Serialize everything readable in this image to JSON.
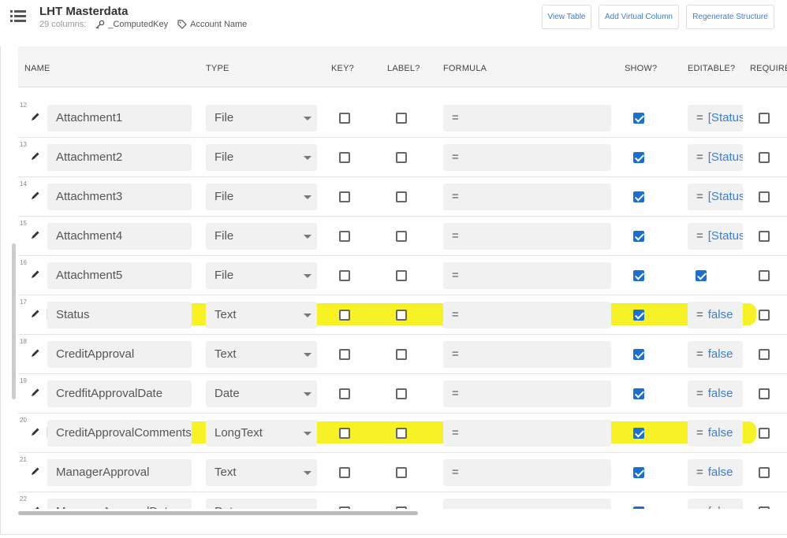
{
  "header": {
    "title": "LHT Masterdata",
    "columns_count": "29 columns:",
    "key_label": "_ComputedKey",
    "label_label": "Account Name",
    "btn_view_table": "View Table",
    "btn_add_virtual": "Add Virtual Column",
    "btn_regenerate": "Regenerate Structure"
  },
  "table": {
    "headers": {
      "name": "NAME",
      "type": "TYPE",
      "key": "KEY?",
      "label": "LABEL?",
      "formula": "FORMULA",
      "show": "SHOW?",
      "editable": "EDITABLE?",
      "require": "REQUIRE"
    },
    "rows": [
      {
        "num": "12",
        "name": "Attachment1",
        "type": "File",
        "formula": "=",
        "show": true,
        "editable_kind": "formula",
        "editable_value": "[Status",
        "highlight": false
      },
      {
        "num": "13",
        "name": "Attachment2",
        "type": "File",
        "formula": "=",
        "show": true,
        "editable_kind": "formula",
        "editable_value": "[Status",
        "highlight": false
      },
      {
        "num": "14",
        "name": "Attachment3",
        "type": "File",
        "formula": "=",
        "show": true,
        "editable_kind": "formula",
        "editable_value": "[Status",
        "highlight": false
      },
      {
        "num": "15",
        "name": "Attachment4",
        "type": "File",
        "formula": "=",
        "show": true,
        "editable_kind": "formula",
        "editable_value": "[Status",
        "highlight": false
      },
      {
        "num": "16",
        "name": "Attachment5",
        "type": "File",
        "formula": "=",
        "show": true,
        "editable_kind": "checkbox",
        "editable_value": "",
        "highlight": false
      },
      {
        "num": "17",
        "name": "Status",
        "type": "Text",
        "formula": "=",
        "show": true,
        "editable_kind": "formula",
        "editable_value": "false",
        "highlight": true
      },
      {
        "num": "18",
        "name": "CreditApproval",
        "type": "Text",
        "formula": "=",
        "show": true,
        "editable_kind": "formula",
        "editable_value": "false",
        "highlight": false
      },
      {
        "num": "19",
        "name": "CredfitApprovalDate",
        "type": "Date",
        "formula": "=",
        "show": true,
        "editable_kind": "formula",
        "editable_value": "false",
        "highlight": false
      },
      {
        "num": "20",
        "name": "CreditApprovalComments",
        "type": "LongText",
        "formula": "=",
        "show": true,
        "editable_kind": "formula",
        "editable_value": "false",
        "highlight": true
      },
      {
        "num": "21",
        "name": "ManagerApproval",
        "type": "Text",
        "formula": "=",
        "show": true,
        "editable_kind": "formula",
        "editable_value": "false",
        "highlight": false
      },
      {
        "num": "22",
        "name": "ManagerApprovalDate",
        "type": "Date",
        "formula": "=",
        "show": true,
        "editable_kind": "formula",
        "editable_value": "false",
        "highlight": false
      }
    ]
  },
  "colors": {
    "highlight": "#f4f000",
    "accent": "#3a7fd5",
    "checkbox": "#1a6fd1"
  }
}
